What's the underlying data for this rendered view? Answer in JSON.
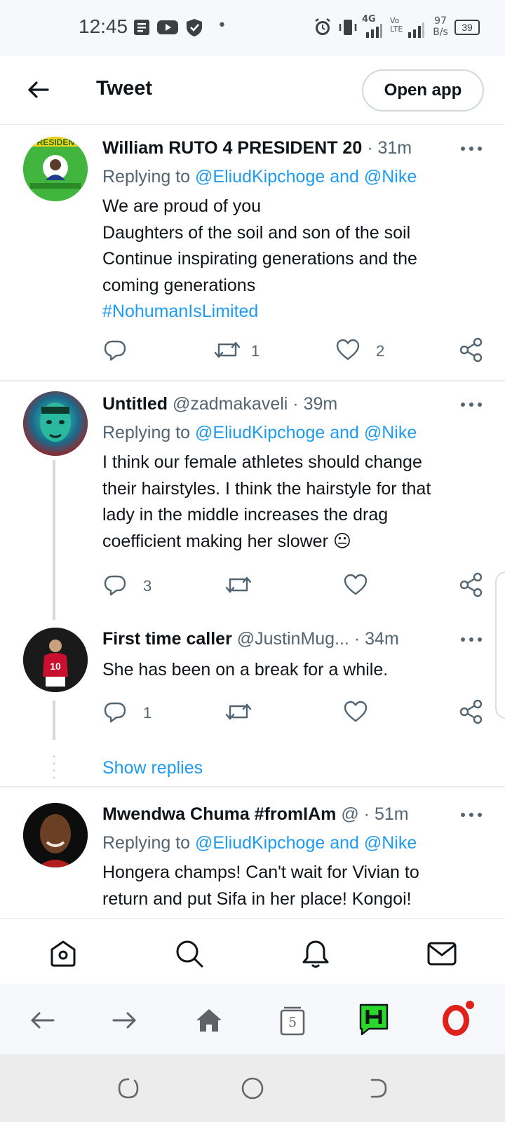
{
  "status_bar": {
    "time": "12:45",
    "network_type": "4G",
    "volte": "Vo LTE",
    "speed_value": "97",
    "speed_unit": "B/s",
    "battery": "39"
  },
  "header": {
    "title": "Tweet",
    "open_app_label": "Open app"
  },
  "tweets": [
    {
      "name": "William RUTO 4 PRESIDENT 20",
      "handle": "",
      "time": "· 31m",
      "replying_prefix": "Replying to",
      "replying_targets": "@EliudKipchoge and @Nike",
      "lines": [
        "We are proud of you",
        "Daughters of the soil and son of the soil",
        "Continue inspirating generations and the",
        "coming generations"
      ],
      "hashtag": "#NohumanIsLimited",
      "reply_count": "",
      "retweet_count": "1",
      "like_count": "2"
    },
    {
      "name": "Untitled",
      "handle": "@zadmakaveli",
      "time": "· 39m",
      "replying_prefix": "Replying to",
      "replying_targets": "@EliudKipchoge and @Nike",
      "lines": [
        "I think our female athletes should change",
        "their hairstyles. I think the hairstyle for that",
        "lady in the middle increases the drag",
        "coefficient making her slower"
      ],
      "emoji": "😐",
      "reply_count": "3",
      "retweet_count": "",
      "like_count": ""
    },
    {
      "name": "First time caller",
      "handle": "@JustinMug...",
      "time": "· 34m",
      "lines": [
        "She has been on a break for a while."
      ],
      "reply_count": "1",
      "retweet_count": "",
      "like_count": ""
    },
    {
      "name": "Mwendwa Chuma #fromIAm",
      "handle": "@",
      "time": "· 51m",
      "replying_prefix": "Replying to",
      "replying_targets": "@EliudKipchoge and @Nike",
      "lines": [
        "Hongera champs! Can't wait for Vivian to",
        "return and put Sifa in her place! Kongoi!"
      ]
    }
  ],
  "show_replies_label": "Show replies",
  "twitter_nav": [
    "home-icon",
    "search-icon",
    "notifications-icon",
    "messages-icon"
  ],
  "browser_bar": {
    "tab_count": "5"
  },
  "colors": {
    "accent": "#1d9bf0",
    "text": "#0f1419",
    "secondary": "#536471",
    "opera_red": "#e0201b",
    "green_app": "#29d82a"
  }
}
